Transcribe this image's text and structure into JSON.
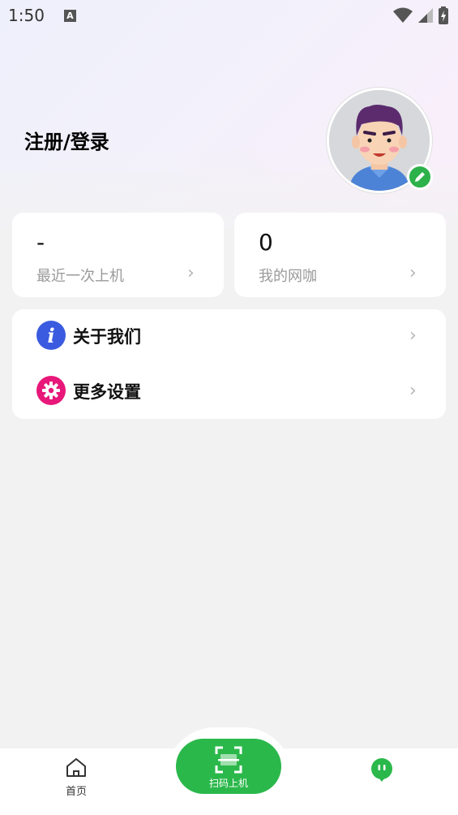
{
  "status_bar": {
    "time": "1:50",
    "notification_letter": "A"
  },
  "profile": {
    "login_label": "注册/登录"
  },
  "stats": [
    {
      "value": "-",
      "label": "最近一次上机"
    },
    {
      "value": "0",
      "label": "我的网咖"
    }
  ],
  "menu": [
    {
      "label": "关于我们",
      "icon": "info-icon",
      "color": "#3a5be0"
    },
    {
      "label": "更多设置",
      "icon": "gear-icon",
      "color": "#e8177a"
    }
  ],
  "tabbar": {
    "home_label": "首页",
    "scan_label": "扫码上机"
  },
  "colors": {
    "accent": "#2bb84b"
  }
}
